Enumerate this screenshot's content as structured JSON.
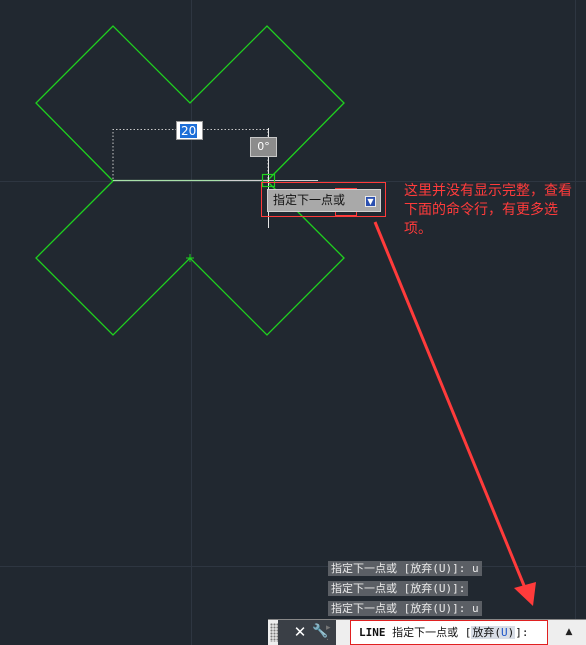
{
  "drawing": {
    "colors": {
      "background": "#212830",
      "grid": "#2e3641",
      "shape_stroke": "#1fd11f",
      "annotation": "#ff3b3b"
    }
  },
  "dynamic_input": {
    "distance_value": "20",
    "angle_value": "0°"
  },
  "prompt_tooltip": {
    "text": "指定下一点或",
    "dropdown_icon": "arrow-down-icon"
  },
  "annotation": {
    "text": "这里并没有显示完整，查看下面的命令行，有更多选项。"
  },
  "command_history": [
    "指定下一点或 [放弃(U)]: u",
    "指定下一点或 [放弃(U)]:",
    "指定下一点或 [放弃(U)]: u"
  ],
  "command_line": {
    "command": "LINE",
    "prompt": "指定下一点或",
    "bracket_open": "[",
    "option_label": "放弃(",
    "option_key": "U",
    "option_close": ")",
    "bracket_close": "]:",
    "close_icon": "close-icon",
    "customize_icon": "wrench-icon",
    "history_toggle_icon": "caret-up-icon"
  }
}
